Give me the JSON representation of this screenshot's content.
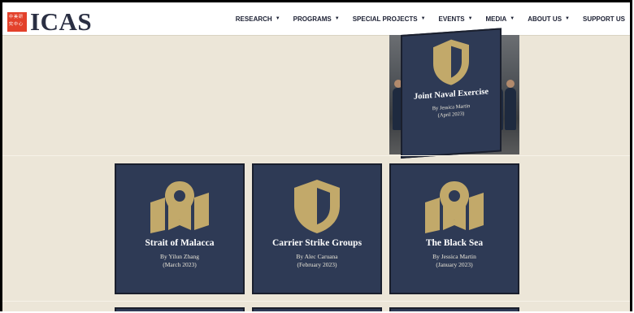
{
  "header": {
    "logo_text": "ICAS",
    "logo_chinese": [
      "中",
      "美",
      "研",
      "究",
      "中",
      "心"
    ],
    "menu": [
      {
        "label": "RESEARCH",
        "has_caret": true
      },
      {
        "label": "PROGRAMS",
        "has_caret": true
      },
      {
        "label": "SPECIAL PROJECTS",
        "has_caret": true
      },
      {
        "label": "EVENTS",
        "has_caret": true
      },
      {
        "label": "MEDIA",
        "has_caret": true
      },
      {
        "label": "ABOUT US",
        "has_caret": true
      },
      {
        "label": "SUPPORT US",
        "has_caret": false
      }
    ]
  },
  "featured": {
    "title": "Joint Naval Exercise",
    "byline": "By Jessica Martin",
    "date": "(April 2023)",
    "icon": "shield-icon"
  },
  "cards": [
    {
      "title": "Strait of Malacca",
      "byline": "By Yilun Zhang",
      "date": "(March 2023)",
      "icon": "map-pin-icon"
    },
    {
      "title": "Carrier Strike Groups",
      "byline": "By Alec Caruana",
      "date": "(February 2023)",
      "icon": "shield-icon"
    },
    {
      "title": "The Black Sea",
      "byline": "By Jessica Martin",
      "date": "(January 2023)",
      "icon": "map-pin-icon"
    }
  ],
  "colors": {
    "background": "#ece6d8",
    "card": "#2e3a55",
    "icon_gold": "#c2a96a",
    "logo_red": "#e3412b",
    "navy_text": "#2a2f43"
  }
}
